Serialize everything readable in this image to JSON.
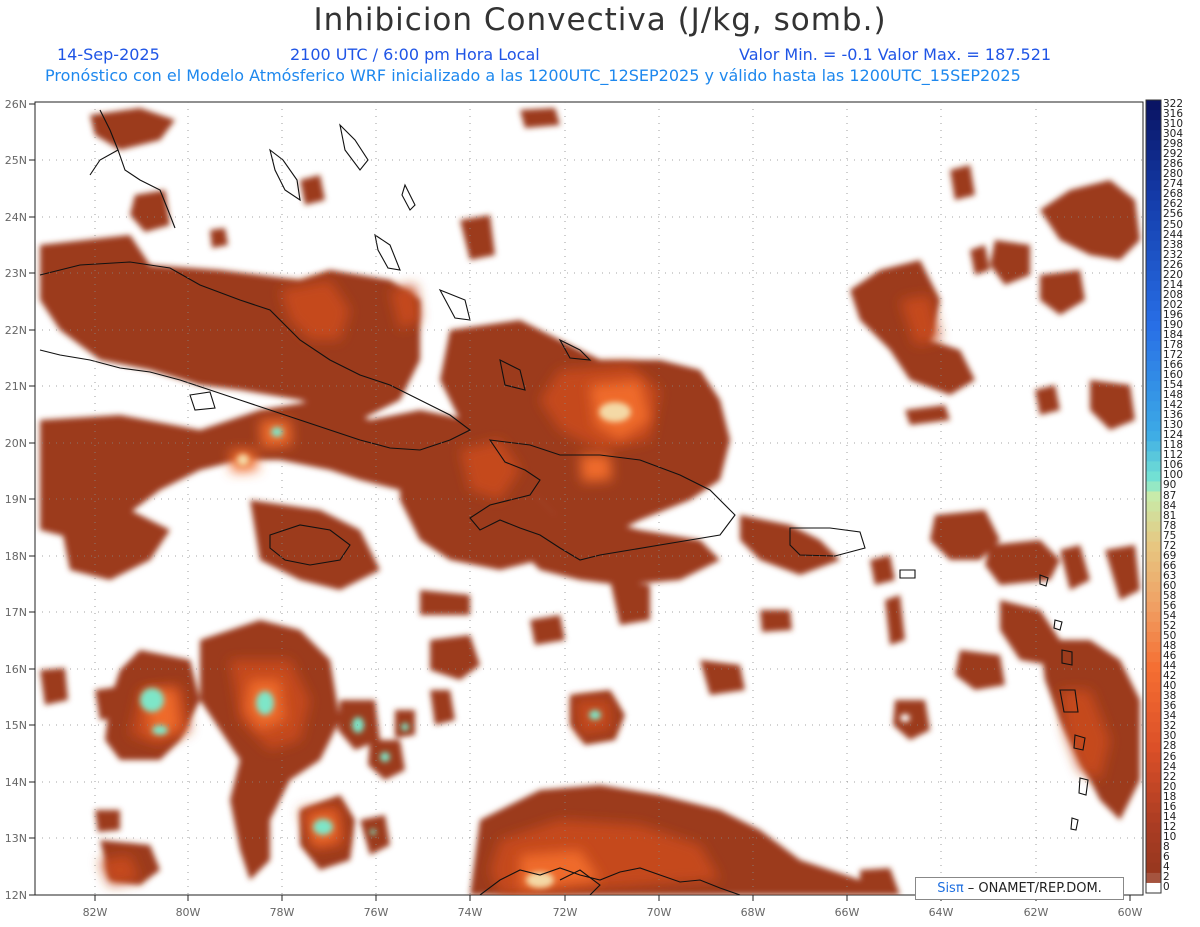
{
  "title": "Inhibicion Convectiva (J/kg, somb.)",
  "header": {
    "date": "14-Sep-2025",
    "time": "2100 UTC / 6:00 pm Hora Local",
    "minmax": "Valor Min. = -0.1   Valor Max. = 187.521",
    "model_line": "Pronóstico con el Modelo Atmósferico WRF inicializado a las 1200UTC_12SEP2025 y válido hasta las  1200UTC_15SEP2025"
  },
  "axes": {
    "lon_labels": [
      "82W",
      "80W",
      "78W",
      "76W",
      "74W",
      "72W",
      "70W",
      "68W",
      "66W",
      "64W",
      "62W",
      "60W"
    ],
    "lat_labels": [
      "26N",
      "25N",
      "24N",
      "23N",
      "22N",
      "21N",
      "20N",
      "19N",
      "18N",
      "17N",
      "16N",
      "15N",
      "14N",
      "13N",
      "12N"
    ]
  },
  "colorbar": {
    "labels": [
      "322",
      "316",
      "310",
      "304",
      "298",
      "292",
      "286",
      "280",
      "274",
      "268",
      "262",
      "256",
      "250",
      "244",
      "238",
      "232",
      "226",
      "220",
      "214",
      "208",
      "202",
      "196",
      "190",
      "184",
      "178",
      "172",
      "166",
      "160",
      "154",
      "148",
      "142",
      "136",
      "130",
      "124",
      "118",
      "112",
      "106",
      "100",
      "90",
      "87",
      "84",
      "81",
      "78",
      "75",
      "72",
      "69",
      "66",
      "63",
      "60",
      "58",
      "56",
      "54",
      "52",
      "50",
      "48",
      "46",
      "44",
      "42",
      "40",
      "38",
      "36",
      "34",
      "32",
      "30",
      "28",
      "26",
      "24",
      "22",
      "20",
      "18",
      "16",
      "14",
      "12",
      "10",
      "8",
      "6",
      "4",
      "2",
      "0"
    ]
  },
  "credit": {
    "logo": "Sisπ",
    "text": " – ONAMET/REP.DOM."
  },
  "colors": {
    "field_base": "#9c3a1e",
    "field_mid": "#c8441a",
    "field_hot": "#f07030",
    "field_peak": "#f5d49a",
    "field_max": "#7ee6c8",
    "coast": "#111111"
  }
}
